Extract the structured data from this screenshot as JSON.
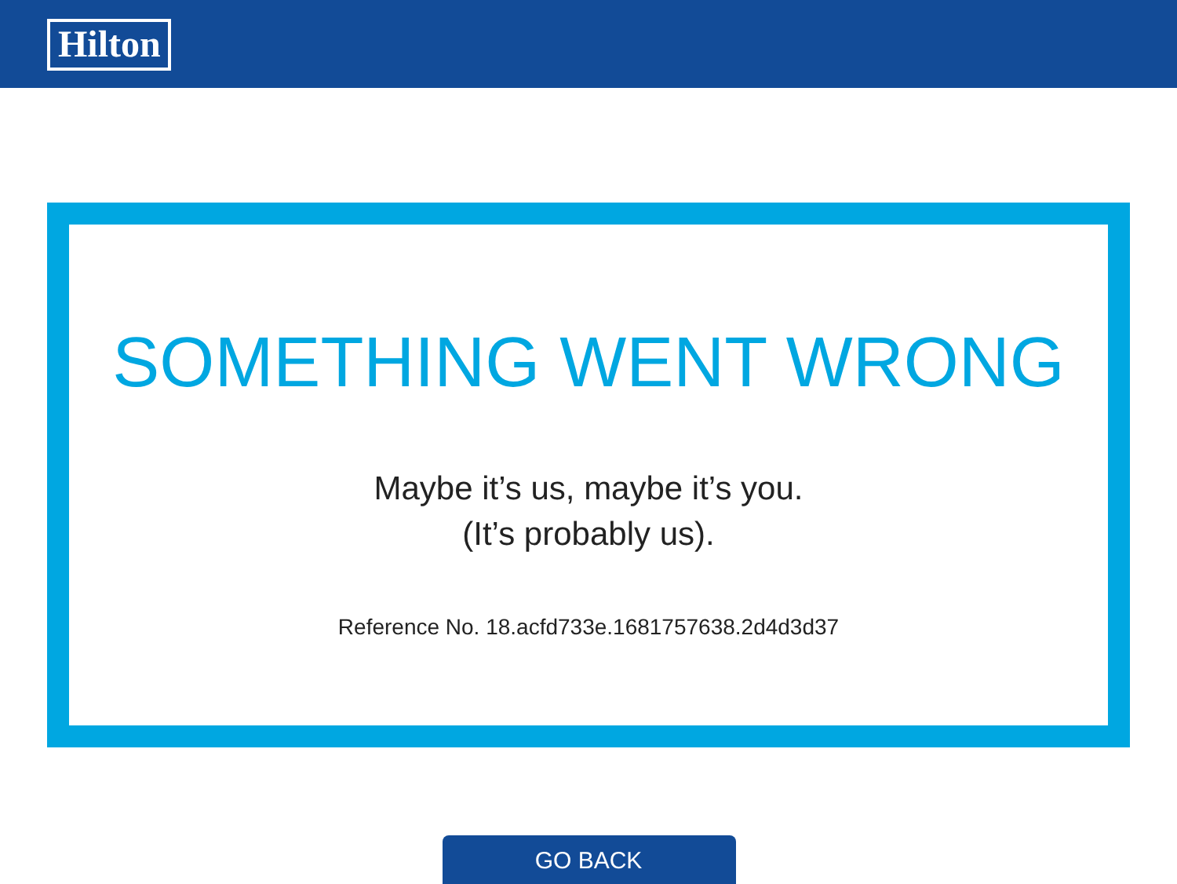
{
  "header": {
    "logo": "Hilton"
  },
  "error": {
    "title": "SOMETHING WENT WRONG",
    "message_lines": [
      "Maybe it’s us, maybe it’s you.",
      "(It’s probably us)."
    ],
    "reference": "Reference No. 18.acfd733e.1681757638.2d4d3d37"
  },
  "button": "GO BACK"
}
